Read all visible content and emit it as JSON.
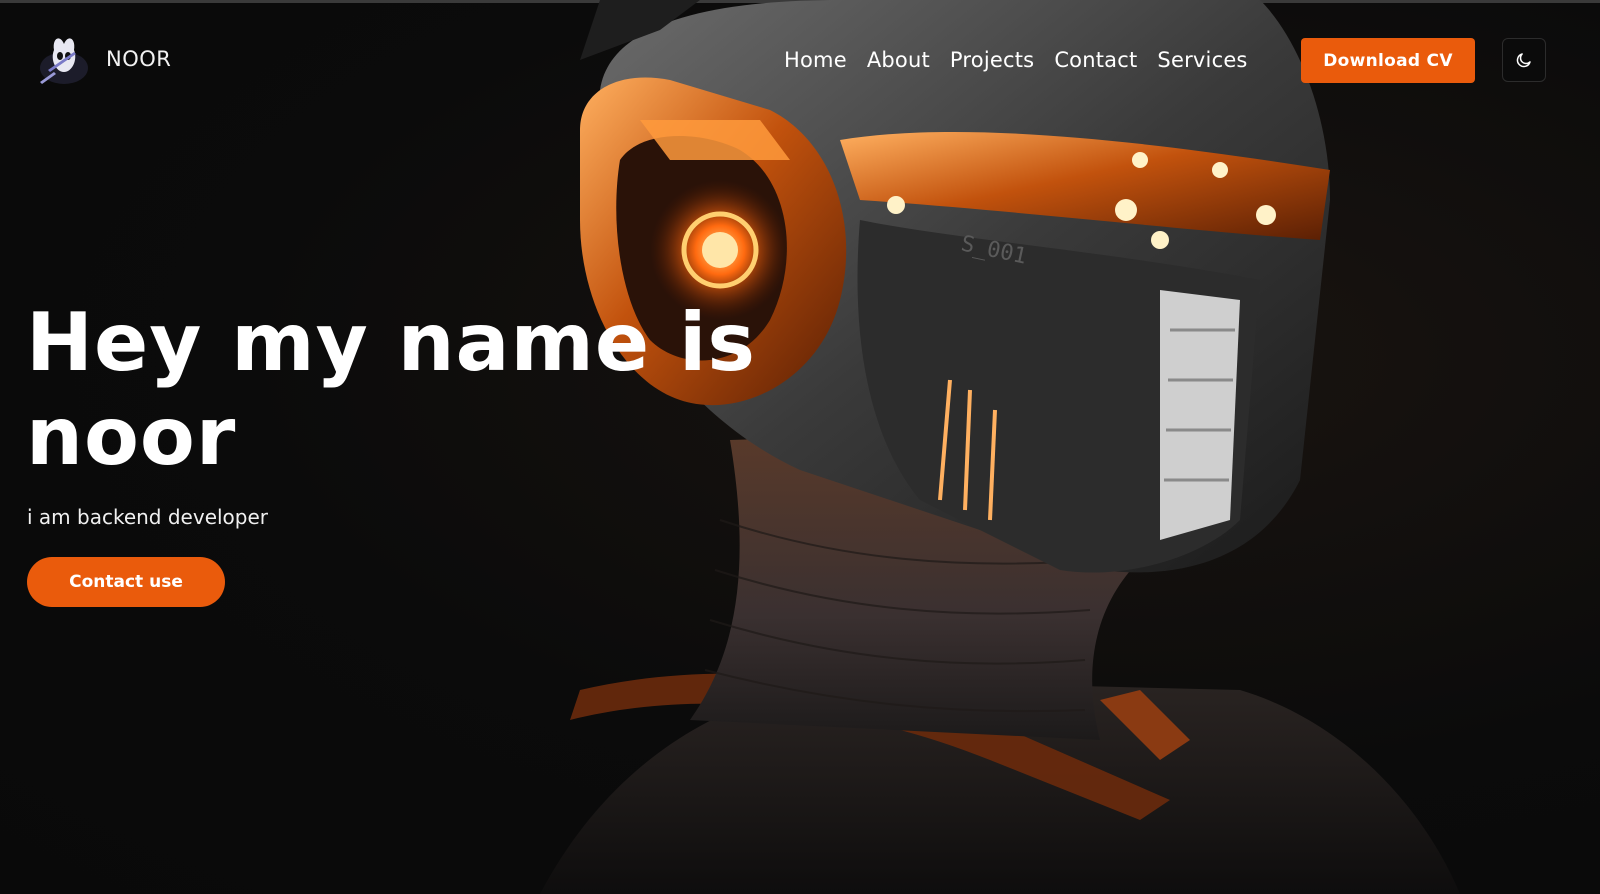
{
  "brand": {
    "name": "NOOR",
    "logo_icon": "knight-helmet-icon"
  },
  "nav": {
    "items": [
      {
        "label": "Home"
      },
      {
        "label": "About"
      },
      {
        "label": "Projects"
      },
      {
        "label": "Contact"
      },
      {
        "label": "Services"
      }
    ]
  },
  "header": {
    "cv_label": "Download CV",
    "theme_icon": "moon-icon"
  },
  "hero": {
    "title": "Hey my name is noor",
    "subtitle": "i am backend developer",
    "cta_label": "Contact use",
    "image_icon": "cyborg-helmet-illustration"
  },
  "colors": {
    "accent": "#ea5b0c",
    "background": "#0a0a0a",
    "text": "#ffffff"
  }
}
